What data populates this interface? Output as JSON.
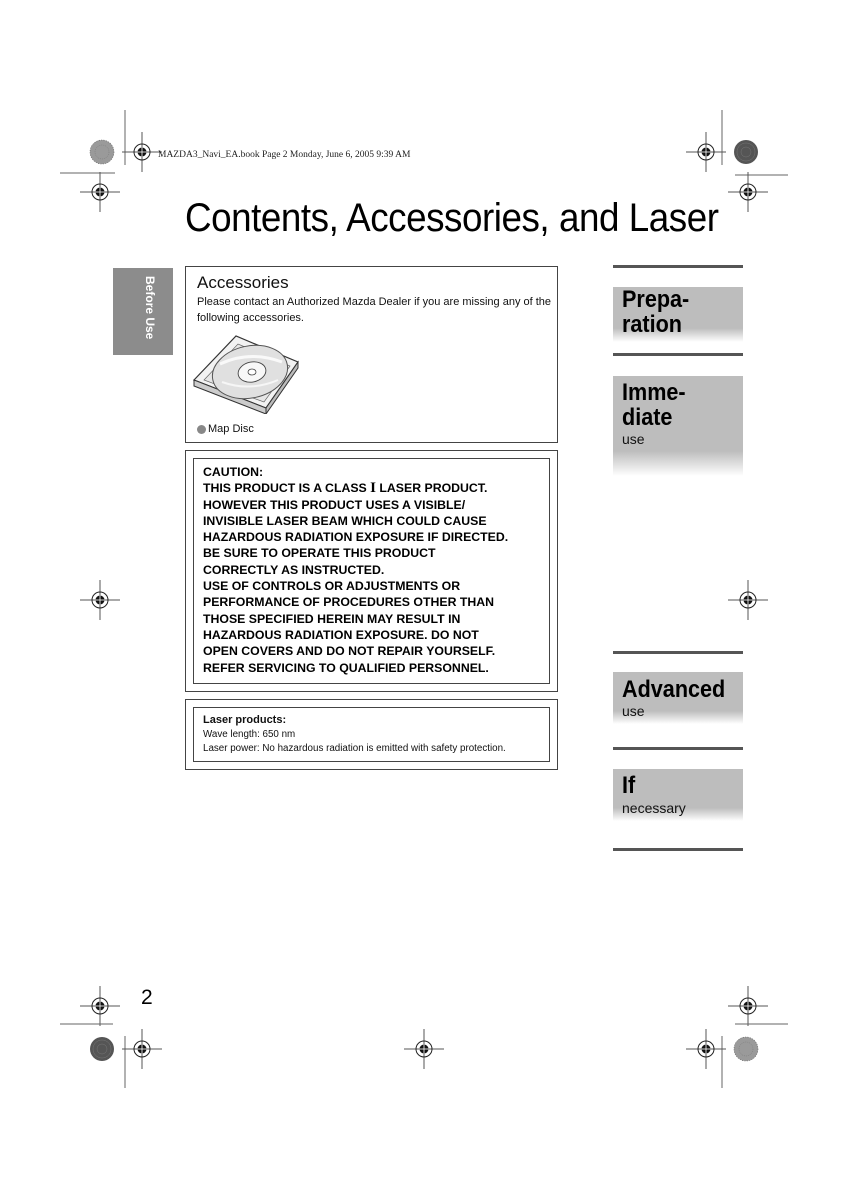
{
  "print_header": "MAZDA3_Navi_EA.book  Page 2  Monday, June 6, 2005  9:39 AM",
  "page_title": "Contents, Accessories, and Laser",
  "side_tab": {
    "label": "Before Use",
    "color": "#8c8c8c"
  },
  "accessories": {
    "title": "Accessories",
    "description": "Please contact an Authorized Mazda Dealer if you are missing any of the following accessories.",
    "image_icon": "cd-case-icon",
    "items": [
      {
        "label": "Map Disc",
        "bullet_color": "#888888"
      }
    ]
  },
  "caution": {
    "heading": "CAUTION:",
    "line1_pre": "THIS PRODUCT IS A CLASS ",
    "line1_class": "I",
    "line1_post": " LASER PRODUCT.",
    "lines": [
      "HOWEVER THIS PRODUCT USES A VISIBLE/",
      "INVISIBLE LASER BEAM WHICH COULD CAUSE",
      "HAZARDOUS RADIATION EXPOSURE IF DIRECTED.",
      "BE SURE TO OPERATE THIS PRODUCT",
      "CORRECTLY AS INSTRUCTED.",
      "USE OF CONTROLS OR ADJUSTMENTS OR",
      "PERFORMANCE OF PROCEDURES OTHER THAN",
      "THOSE SPECIFIED HEREIN MAY RESULT IN",
      "HAZARDOUS RADIATION EXPOSURE. DO NOT",
      "OPEN COVERS AND DO NOT REPAIR YOURSELF.",
      "REFER SERVICING TO QUALIFIED PERSONNEL."
    ]
  },
  "laser_products": {
    "heading": "Laser products:",
    "wave_length": "Wave length: 650 nm",
    "laser_power": "Laser power: No hazardous radiation is emitted with safety protection."
  },
  "sections": [
    {
      "title_line1": "Prepa-",
      "title_line2": "ration",
      "subtitle": ""
    },
    {
      "title_line1": "Imme-",
      "title_line2": "diate",
      "subtitle": "use"
    },
    {
      "title_line1": "Advanced",
      "title_line2": "",
      "subtitle": "use"
    },
    {
      "title_line1": "If",
      "title_line2": "",
      "subtitle": "necessary"
    }
  ],
  "section_color": "#bdbdbd",
  "page_number": "2"
}
